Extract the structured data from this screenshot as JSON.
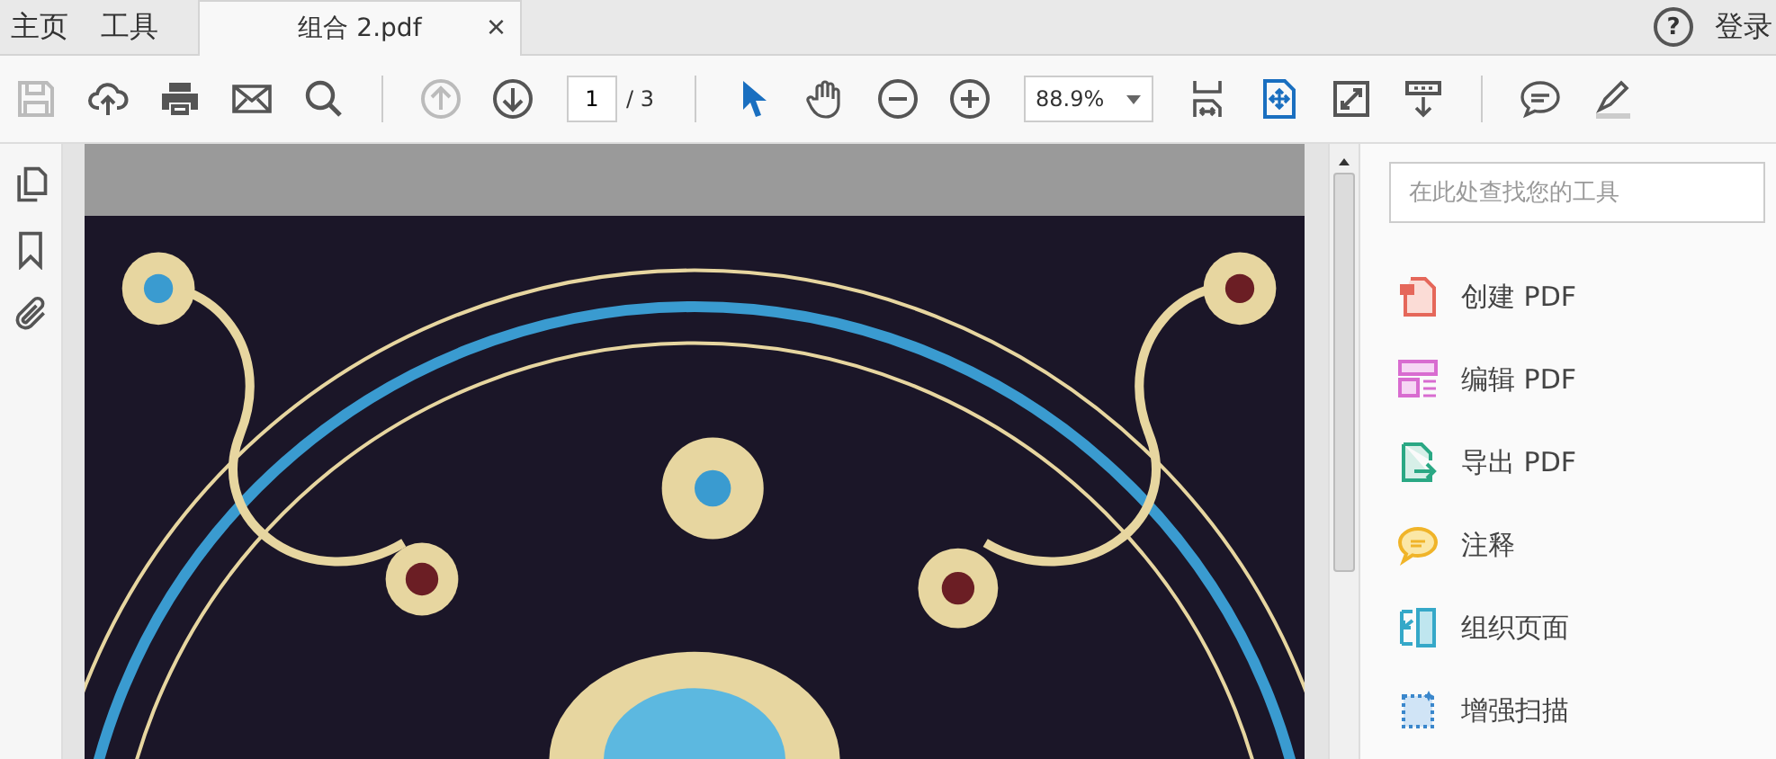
{
  "top_tabs": [
    {
      "label": "主页",
      "selected": false
    },
    {
      "label": "工具",
      "selected": false
    }
  ],
  "document_tab": {
    "label": "组合 2.pdf",
    "close": "×",
    "selected": true
  },
  "account": {
    "help": "?",
    "sign_in": "登录"
  },
  "toolbar": {
    "buttons": [
      {
        "kind": "save",
        "disabled": true
      },
      {
        "kind": "upload",
        "disabled": false
      },
      {
        "kind": "print",
        "disabled": false
      },
      {
        "kind": "mail",
        "disabled": false
      },
      {
        "kind": "search",
        "disabled": false
      },
      {
        "kind": "sep"
      },
      {
        "kind": "prev",
        "disabled": true
      },
      {
        "kind": "next",
        "disabled": false
      },
      {
        "kind": "page"
      },
      {
        "kind": "sep"
      },
      {
        "kind": "pointer",
        "selected": true
      },
      {
        "kind": "hand",
        "selected": false
      },
      {
        "kind": "zoomout",
        "disabled": false
      },
      {
        "kind": "zoomin",
        "disabled": false
      },
      {
        "kind": "zoom"
      },
      {
        "kind": "fitpage",
        "disabled": false
      },
      {
        "kind": "fitwidth"
      },
      {
        "kind": "fullscreen",
        "disabled": false
      },
      {
        "kind": "scroll",
        "disabled": false
      },
      {
        "kind": "sep"
      },
      {
        "kind": "comment",
        "disabled": false
      },
      {
        "kind": "highlight",
        "disabled": false
      }
    ],
    "page_number": "1",
    "page_total": "/ 3",
    "zoom": "88.9%"
  },
  "side_rail": [
    {
      "kind": "pages"
    },
    {
      "kind": "bookmark"
    },
    {
      "kind": "attachment"
    }
  ],
  "tools_panel": {
    "search": {
      "placeholder": "在此处查找您的工具"
    },
    "items": [
      {
        "kind": "create",
        "label": "创建 PDF"
      },
      {
        "kind": "edit",
        "label": "编辑 PDF"
      },
      {
        "kind": "export",
        "label": "导出 PDF"
      },
      {
        "kind": "comment",
        "label": "注释"
      },
      {
        "kind": "organize",
        "label": "组织页面"
      },
      {
        "kind": "scan",
        "label": "增强扫描"
      }
    ]
  }
}
